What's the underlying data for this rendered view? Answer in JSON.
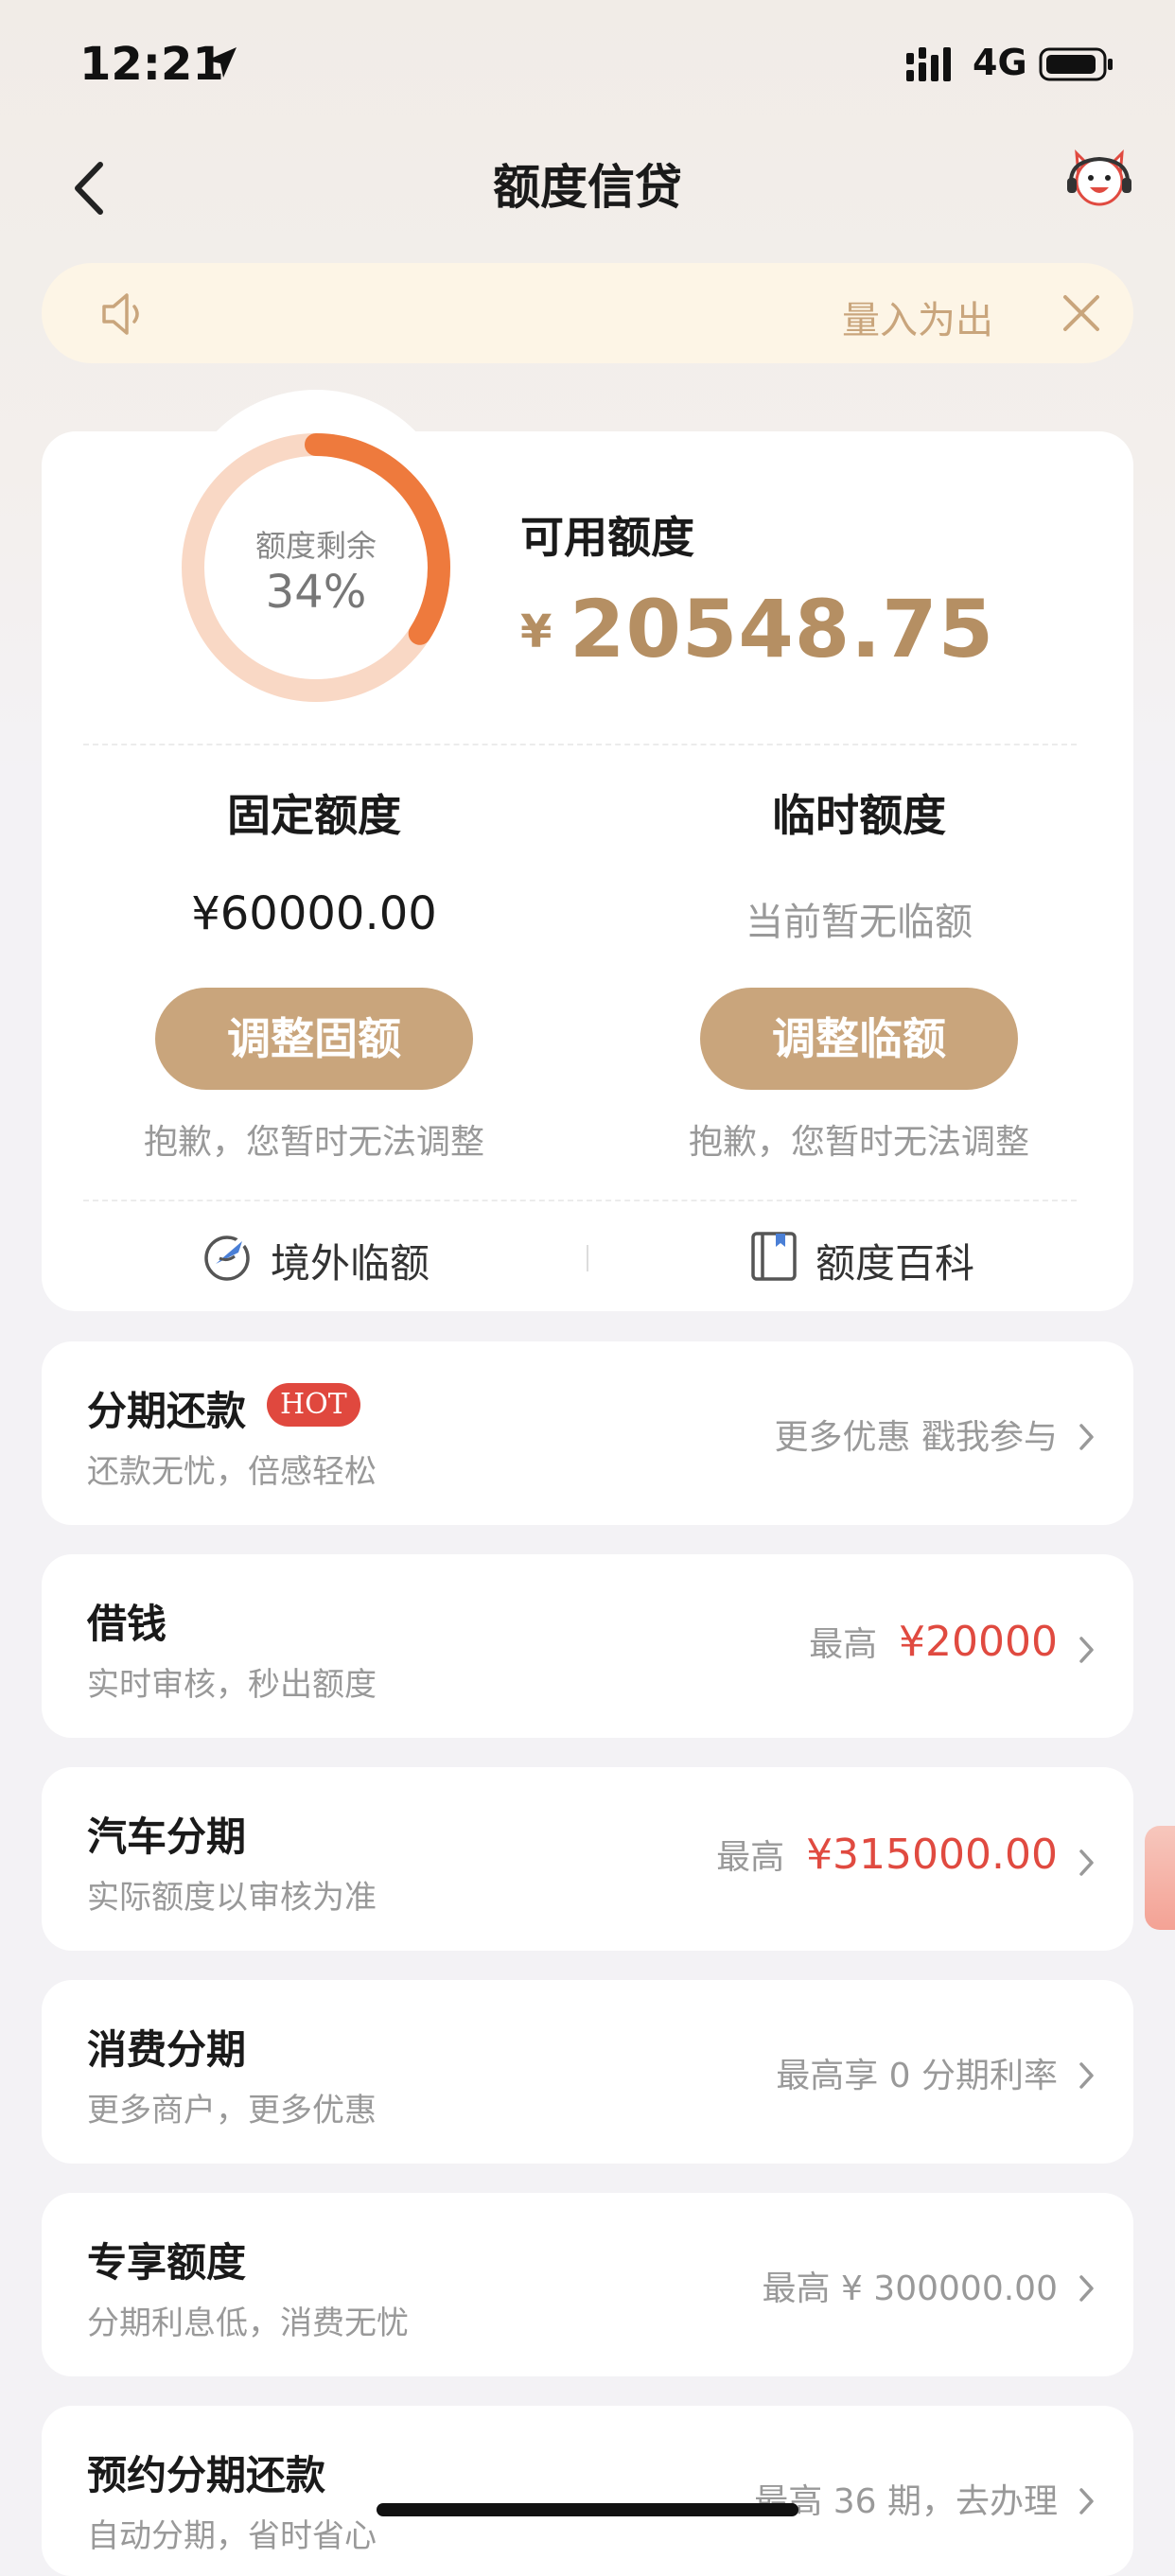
{
  "status_bar": {
    "time": "12:21",
    "network": "4G"
  },
  "nav": {
    "title": "额度信贷"
  },
  "notice": {
    "text": "量入为出"
  },
  "credit": {
    "ring_label": "额度剩余",
    "ring_percent": "34%",
    "remaining_fraction": 0.34,
    "available_label": "可用额度",
    "available_currency": "¥",
    "available_amount": "20548.75",
    "fixed": {
      "title": "固定额度",
      "amount": "¥60000.00",
      "button": "调整固额",
      "note": "抱歉，您暂时无法调整"
    },
    "temporary": {
      "title": "临时额度",
      "status": "当前暂无临额",
      "button": "调整临额",
      "note": "抱歉，您暂时无法调整"
    },
    "links": {
      "overseas": "境外临额",
      "encyclopedia": "额度百科"
    }
  },
  "rows": [
    {
      "title": "分期还款",
      "badge": "HOT",
      "subtitle": "还款无忧，倍感轻松",
      "right": "更多优惠 戳我参与",
      "highlight": ""
    },
    {
      "title": "借钱",
      "subtitle": "实时审核，秒出额度",
      "right": "最高",
      "highlight": "¥20000"
    },
    {
      "title": "汽车分期",
      "subtitle": "实际额度以审核为准",
      "right": "最高",
      "highlight": "¥315000.00"
    },
    {
      "title": "消费分期",
      "subtitle": "更多商户，更多优惠",
      "right": "最高享 0 分期利率",
      "highlight": ""
    },
    {
      "title": "专享额度",
      "subtitle": "分期利息低，消费无忧",
      "right": "最高 ¥ 300000.00",
      "highlight": ""
    },
    {
      "title": "预约分期还款",
      "subtitle": "自动分期，省时省心",
      "right": "最高 36 期，去办理",
      "highlight": ""
    }
  ],
  "colors": {
    "accent": "#c9a57c",
    "ring": "#ee7a3d",
    "ring_track": "#f9d8c5",
    "highlight": "#e04a40"
  }
}
